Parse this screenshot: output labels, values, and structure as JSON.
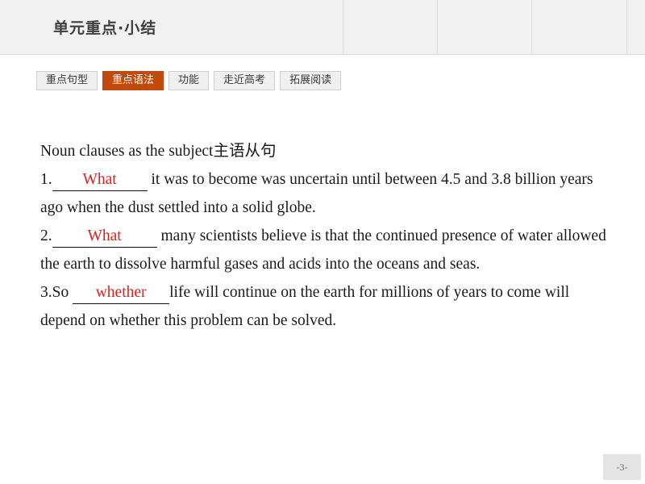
{
  "header": {
    "title": "单元重点·小结",
    "divider_positions": [
      425,
      542,
      659,
      777
    ]
  },
  "tabs": [
    {
      "label": "重点句型",
      "active": false
    },
    {
      "label": "重点语法",
      "active": true
    },
    {
      "label": "功能",
      "active": false
    },
    {
      "label": "走近高考",
      "active": false
    },
    {
      "label": "拓展阅读",
      "active": false
    }
  ],
  "content": {
    "heading": "Noun clauses as the subject主语从句",
    "items": [
      {
        "number": "1.",
        "answer": "What",
        "before": "",
        "after": " it was to become was uncertain until between 4.5 and 3.8 billion years ago when the dust settled into a solid globe."
      },
      {
        "number": "2.",
        "answer": "What",
        "before": "",
        "after": " many scientists believe is that the continued presence of water allowed the earth to dissolve harmful gases and acids into the oceans and seas."
      },
      {
        "number": "3.",
        "answer": "whether",
        "before": "So ",
        "after": "life will continue on the earth for millions of years to come will depend on whether this problem can be solved."
      }
    ]
  },
  "page_badge": {
    "label": "-3-"
  },
  "colors": {
    "accent": "#c1490b",
    "answer_red": "#d9221c",
    "header_bg": "#f1f1f1",
    "tab_bg": "#f0f0f0",
    "badge_bg": "#e4e4e4"
  }
}
